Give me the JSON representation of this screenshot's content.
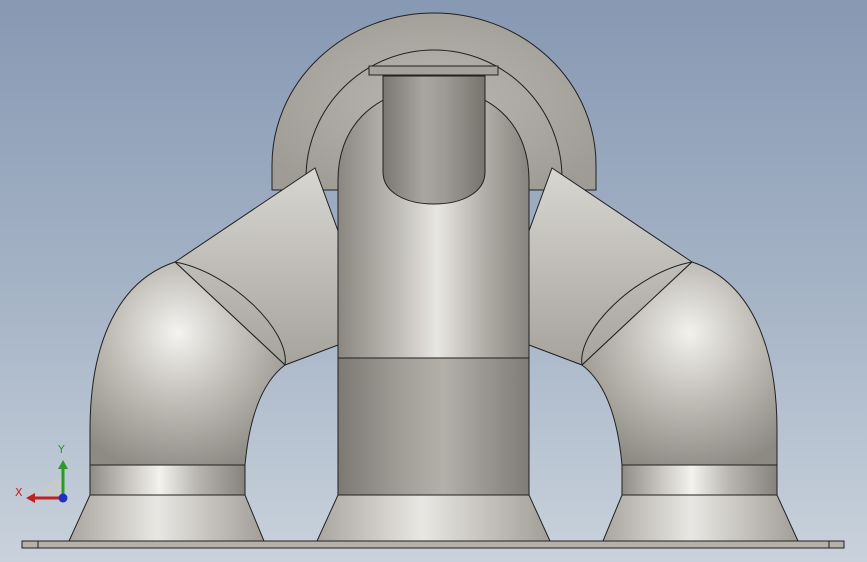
{
  "viewport": {
    "background_top": "#8798b3",
    "background_bottom": "#c9d2dc"
  },
  "model": {
    "surface_color": "#bab7b1",
    "edge_color": "#202020",
    "flange_color": "#a5a29c"
  },
  "triad": {
    "x_label": "X",
    "y_label": "Y",
    "x_color": "#c02020",
    "y_color": "#2a9a2a",
    "z_color": "#2030c0"
  }
}
